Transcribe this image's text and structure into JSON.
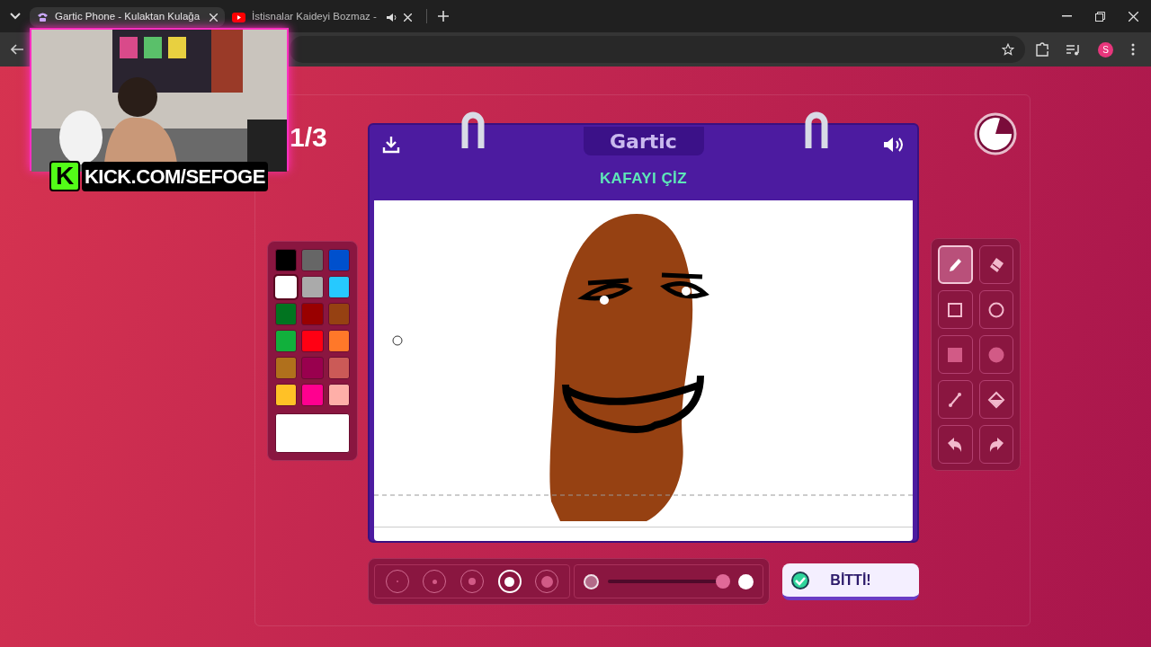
{
  "browser": {
    "tabs": [
      {
        "label": "Gartic Phone - Kulaktan Kulağa",
        "selected": true,
        "kind": "phone"
      },
      {
        "label": "İstisnalar Kaideyi Bozmaz -",
        "selected": false,
        "kind": "video",
        "audio": true
      }
    ],
    "profile_initial": "S"
  },
  "stream_overlay": {
    "logo_letter": "K",
    "channel": "KICK.COM/SEFOGE"
  },
  "round": "1/3",
  "board": {
    "logo": "Gartic",
    "title": "KAFAYI ÇİZ"
  },
  "palette": {
    "colors": [
      {
        "color": "#000000",
        "selected": false
      },
      {
        "color": "#666666",
        "selected": false
      },
      {
        "color": "#0050cd",
        "selected": false
      },
      {
        "color": "#ffffff",
        "selected": true
      },
      {
        "color": "#aaaaaa",
        "selected": false
      },
      {
        "color": "#26c9ff",
        "selected": false
      },
      {
        "color": "#017420",
        "selected": false
      },
      {
        "color": "#990000",
        "selected": false
      },
      {
        "color": "#964112",
        "selected": false
      },
      {
        "color": "#11b03c",
        "selected": false
      },
      {
        "color": "#ff0013",
        "selected": false
      },
      {
        "color": "#ff7829",
        "selected": false
      },
      {
        "color": "#b0701c",
        "selected": false
      },
      {
        "color": "#99004e",
        "selected": false
      },
      {
        "color": "#cb5a57",
        "selected": false
      },
      {
        "color": "#ffc126",
        "selected": false
      },
      {
        "color": "#ff008f",
        "selected": false
      },
      {
        "color": "#feafa8",
        "selected": false
      }
    ]
  },
  "tools": [
    {
      "kind": "pencil",
      "selected": true
    },
    {
      "kind": "eraser",
      "selected": false
    },
    {
      "kind": "square",
      "selected": false
    },
    {
      "kind": "circle",
      "selected": false
    },
    {
      "kind": "square-filled",
      "selected": false
    },
    {
      "kind": "circle-filled",
      "selected": false
    },
    {
      "kind": "line",
      "selected": false
    },
    {
      "kind": "bucket",
      "selected": false
    },
    {
      "kind": "undo",
      "selected": false
    },
    {
      "kind": "redo",
      "selected": false
    }
  ],
  "brush_sizes": [
    {
      "selected": false
    },
    {
      "selected": false
    },
    {
      "selected": false
    },
    {
      "selected": true
    },
    {
      "selected": false
    }
  ],
  "opacity": {
    "level": 0.95
  },
  "done_button": "BİTTİ!"
}
